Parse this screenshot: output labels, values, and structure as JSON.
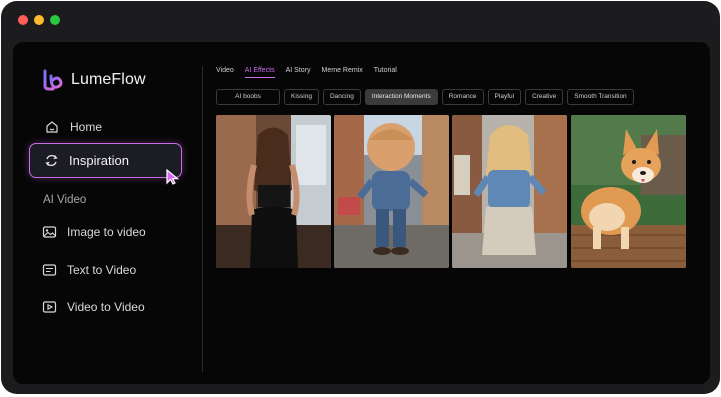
{
  "app": {
    "name": "LumeFlow"
  },
  "window": {
    "controls": [
      "close",
      "minimize",
      "maximize"
    ],
    "colors": [
      "#ff5f57",
      "#febc2e",
      "#28c840"
    ]
  },
  "sidebar": {
    "items": [
      {
        "label": "Home",
        "icon": "home-icon"
      },
      {
        "label": "Inspiration",
        "icon": "refresh-icon",
        "active": true
      }
    ],
    "section": "AI Video",
    "video_items": [
      {
        "label": "Image to video",
        "icon": "image-icon"
      },
      {
        "label": "Text to Video",
        "icon": "text-icon"
      },
      {
        "label": "Video to Video",
        "icon": "video-icon"
      }
    ]
  },
  "tabs": [
    "Video",
    "AI Effects",
    "AI Story",
    "Meme Remix",
    "Tutorial"
  ],
  "active_tab": "AI Effects",
  "chips": [
    "AI boobs",
    "Kissing",
    "Dancing",
    "Interaction Moments",
    "Romance",
    "Playful",
    "Creative",
    "Smooth Transition"
  ],
  "active_chip": "Interaction Moments",
  "thumbnails": [
    {
      "name": "woman-brick-wall-thumbnail"
    },
    {
      "name": "cartoon-child-street-thumbnail"
    },
    {
      "name": "girl-denim-street-thumbnail"
    },
    {
      "name": "corgi-dog-thumbnail"
    }
  ],
  "colors": {
    "accent": "#c86ce8",
    "background": "#060606",
    "frame": "#1c1c1e"
  }
}
